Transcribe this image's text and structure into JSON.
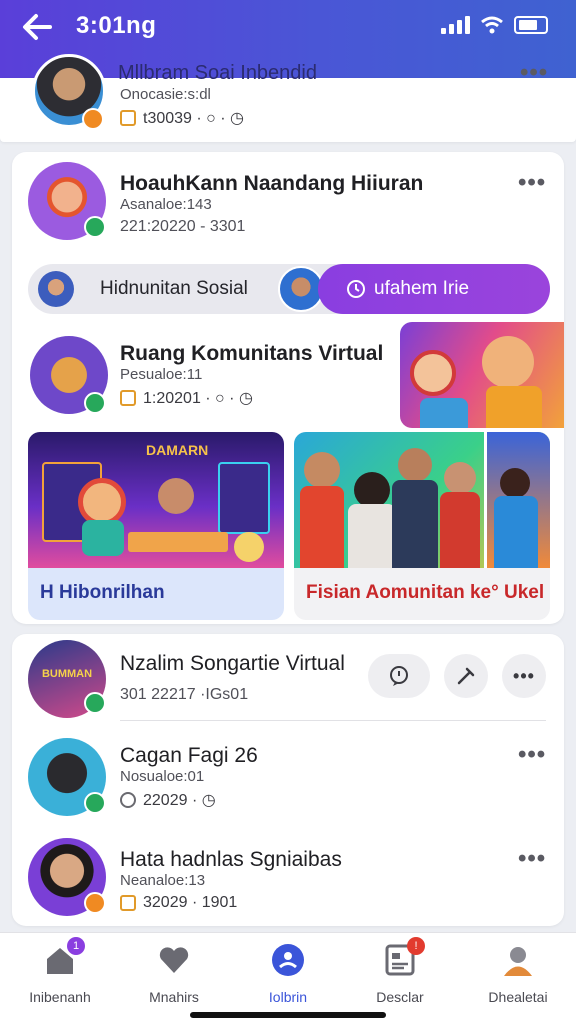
{
  "status_bar": {
    "time": "3:01ng"
  },
  "header": {
    "title": "Mllbram Soai Inbendid"
  },
  "top_card": {
    "subtitle": "Onocasie:s:dl",
    "meta": "t30039 · ○ · ◷"
  },
  "feed_card": {
    "title": "HoauhKann Naandang Hiiuran",
    "subtitle": "Asanaloe:143",
    "meta": "221:20220 - 3301",
    "pill_left_label": "Hidnunitan Sosial",
    "pill_right_label": "ufahem Irie",
    "community": {
      "title": "Ruang Komunitans Virtual",
      "subtitle": "Pesualoe:11",
      "meta": "1:20201 · ○ · ◷"
    },
    "media": [
      {
        "caption": "H Hibonrilhan",
        "poster_text": "DAMARN",
        "caption_color": "#2a3a9a"
      },
      {
        "caption": "Fisian Aomunitan ke° Ukel",
        "caption_color": "#c8282a"
      }
    ]
  },
  "list_card": {
    "items": [
      {
        "title": "Nzalim Songartie Virtual",
        "subtitle": "301 22217 ·IGs01",
        "poster_text": "BUMMAN"
      },
      {
        "title": "Cagan Fagi 26",
        "subtitle": "Nosualoe:01",
        "meta": "22029 · ◷"
      },
      {
        "title": "Hata hadnlas Sgniaibas",
        "subtitle": "Neanaloe:13",
        "meta": "32029 · 1901"
      }
    ]
  },
  "nav": {
    "items": [
      {
        "label": "Inibenanh",
        "badge": "1",
        "icon": "home-icon"
      },
      {
        "label": "Mnahirs",
        "icon": "heart-icon"
      },
      {
        "label": "Iolbrin",
        "icon": "profile-icon",
        "active": true
      },
      {
        "label": "Desclar",
        "badge": "!",
        "icon": "document-icon"
      },
      {
        "label": "Dhealetai",
        "icon": "avatar-icon"
      }
    ]
  },
  "colors": {
    "accent": "#5a3fd9",
    "purple_pill": "#8a3ee0",
    "active_nav": "#3b55d9",
    "badge_red": "#e23b2f"
  }
}
